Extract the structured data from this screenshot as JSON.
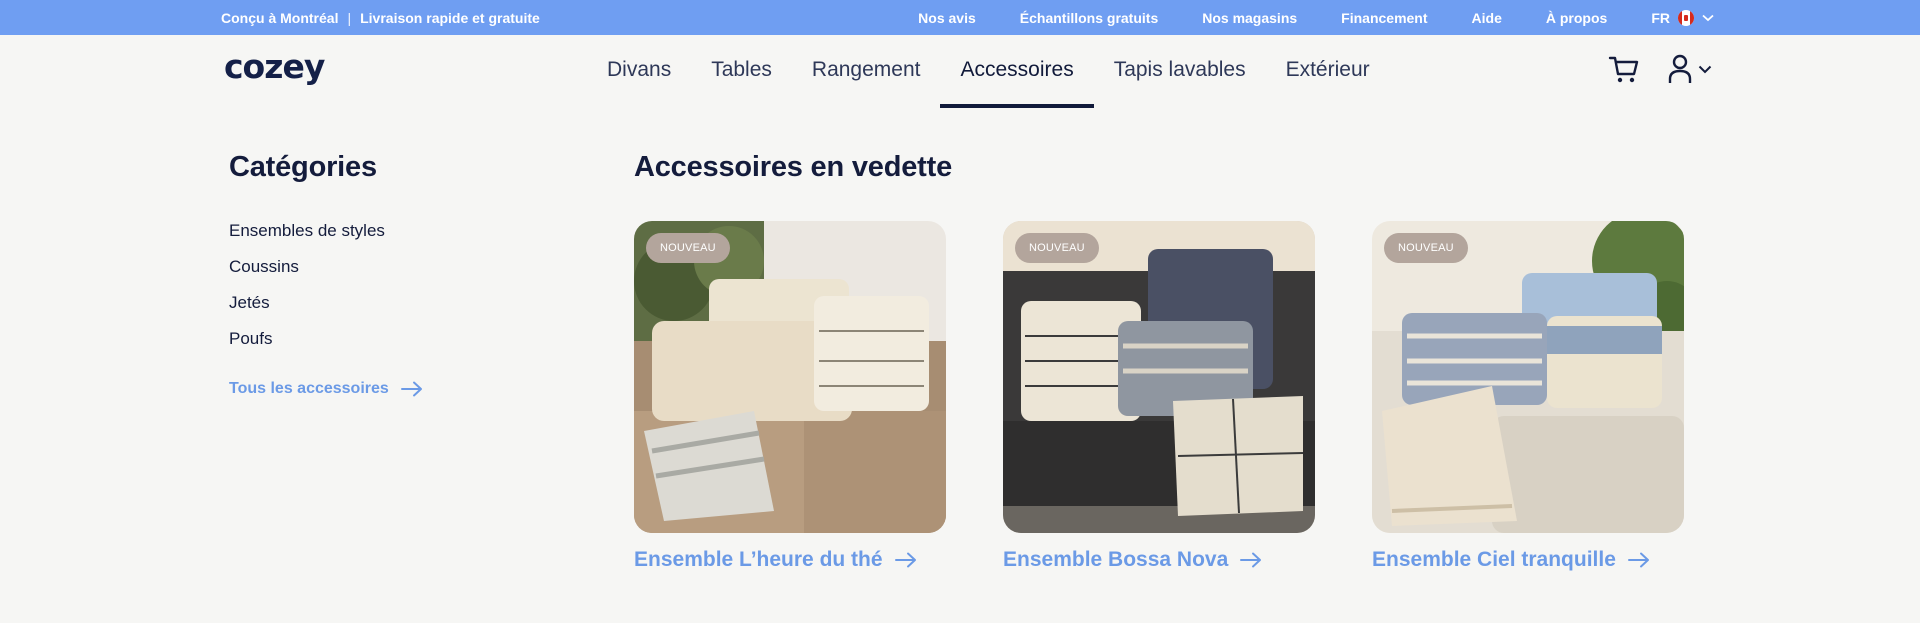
{
  "topbar": {
    "tagline_left": "Conçu à Montréal",
    "tagline_sep": "|",
    "tagline_right": "Livraison rapide et gratuite",
    "links": [
      "Nos avis",
      "Échantillons gratuits",
      "Nos magasins",
      "Financement",
      "Aide",
      "À propos"
    ],
    "language": "FR",
    "flag_icon": "canada-flag-icon"
  },
  "header": {
    "logo": "cozey",
    "nav": [
      "Divans",
      "Tables",
      "Rangement",
      "Accessoires",
      "Tapis lavables",
      "Extérieur"
    ],
    "active_nav": "Accessoires",
    "cart_icon": "cart-icon",
    "account_icon": "user-icon"
  },
  "sidebar": {
    "title": "Catégories",
    "items": [
      "Ensembles de styles",
      "Coussins",
      "Jetés",
      "Poufs"
    ],
    "all_link": "Tous les accessoires"
  },
  "featured": {
    "title": "Accessoires en vedette",
    "cards": [
      {
        "badge": "NOUVEAU",
        "label": "Ensemble L’heure du thé"
      },
      {
        "badge": "NOUVEAU",
        "label": "Ensemble Bossa Nova"
      },
      {
        "badge": "NOUVEAU",
        "label": "Ensemble Ciel tranquille"
      }
    ]
  },
  "colors": {
    "topbar_bg": "#6f9ef2",
    "link_blue": "#6b9ae6",
    "navy": "#141c3c",
    "badge_bg": "#b3a59c",
    "page_bg": "#f6f6f4"
  }
}
